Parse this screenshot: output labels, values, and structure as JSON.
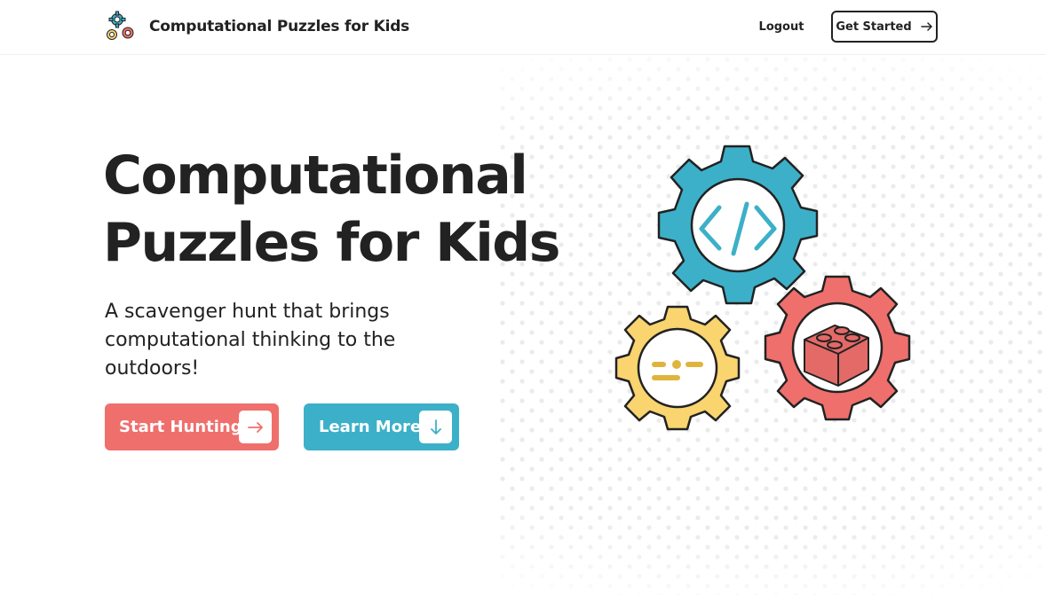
{
  "nav": {
    "brand_title": "Computational Puzzles for Kids",
    "logo_icon": "gears-logo-icon",
    "logout_label": "Logout",
    "cta_label": "Get Started",
    "cta_icon": "arrow-right-icon"
  },
  "hero": {
    "title_line1": "Computational",
    "title_line2": "Puzzles for Kids",
    "subtitle": "A scavenger hunt that brings computational thinking to the outdoors!",
    "primary_button": {
      "label": "Start Hunting",
      "icon": "arrow-right-icon"
    },
    "secondary_button": {
      "label": "Learn More",
      "icon": "arrow-down-icon"
    }
  },
  "illustration": {
    "gears": [
      {
        "name": "code-gear",
        "icon": "code-brackets-icon",
        "color": "#3cb0c8"
      },
      {
        "name": "dots-gear",
        "icon": "dash-dot-icon",
        "color": "#f9d46f"
      },
      {
        "name": "brick-gear",
        "icon": "lego-brick-icon",
        "color": "#ef6f6c"
      }
    ]
  },
  "colors": {
    "text": "#222222",
    "accent_red": "#ef6f6c",
    "accent_teal": "#3cb0c8",
    "accent_yellow": "#f9d46f",
    "dot_pattern": "#ececec"
  }
}
